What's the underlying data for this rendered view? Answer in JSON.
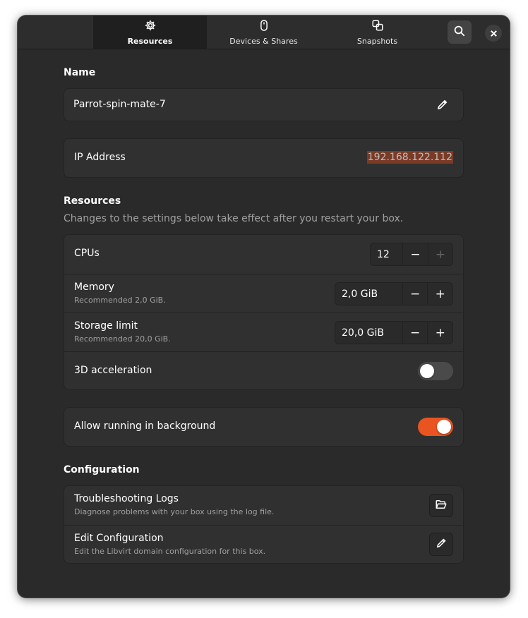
{
  "header": {
    "tabs": [
      {
        "label": "Resources",
        "icon": "gear-icon",
        "active": true
      },
      {
        "label": "Devices & Shares",
        "icon": "mouse-icon",
        "active": false
      },
      {
        "label": "Snapshots",
        "icon": "copy-icon",
        "active": false
      }
    ],
    "search_icon": "search-icon",
    "close_icon": "close-icon"
  },
  "name_section": {
    "heading": "Name",
    "value": "Parrot-spin-mate-7",
    "edit_icon": "pencil-icon"
  },
  "ip": {
    "label": "IP Address",
    "value": "192.168.122.112"
  },
  "resources": {
    "heading": "Resources",
    "subtitle": "Changes to the settings below take effect after you restart your box.",
    "cpus": {
      "label": "CPUs",
      "value": "12",
      "minus": "−",
      "plus": "+",
      "plus_enabled": false
    },
    "memory": {
      "label": "Memory",
      "sub": "Recommended 2,0 GiB.",
      "value": "2,0 GiB",
      "minus": "−",
      "plus": "+"
    },
    "storage": {
      "label": "Storage limit",
      "sub": "Recommended 20,0 GiB.",
      "value": "20,0 GiB",
      "minus": "−",
      "plus": "+"
    },
    "accel": {
      "label": "3D acceleration",
      "on": false
    }
  },
  "background": {
    "label": "Allow running in background",
    "on": true
  },
  "configuration": {
    "heading": "Configuration",
    "logs": {
      "title": "Troubleshooting Logs",
      "sub": "Diagnose problems with your box using the log file.",
      "icon": "folder-open-icon"
    },
    "edit": {
      "title": "Edit Configuration",
      "sub": "Edit the Libvirt domain configuration for this box.",
      "icon": "pencil-icon"
    }
  },
  "colors": {
    "accent": "#e95420",
    "window_bg": "#2a2a2a",
    "card_bg": "#303030",
    "ip_highlight": "#7a3b26"
  }
}
